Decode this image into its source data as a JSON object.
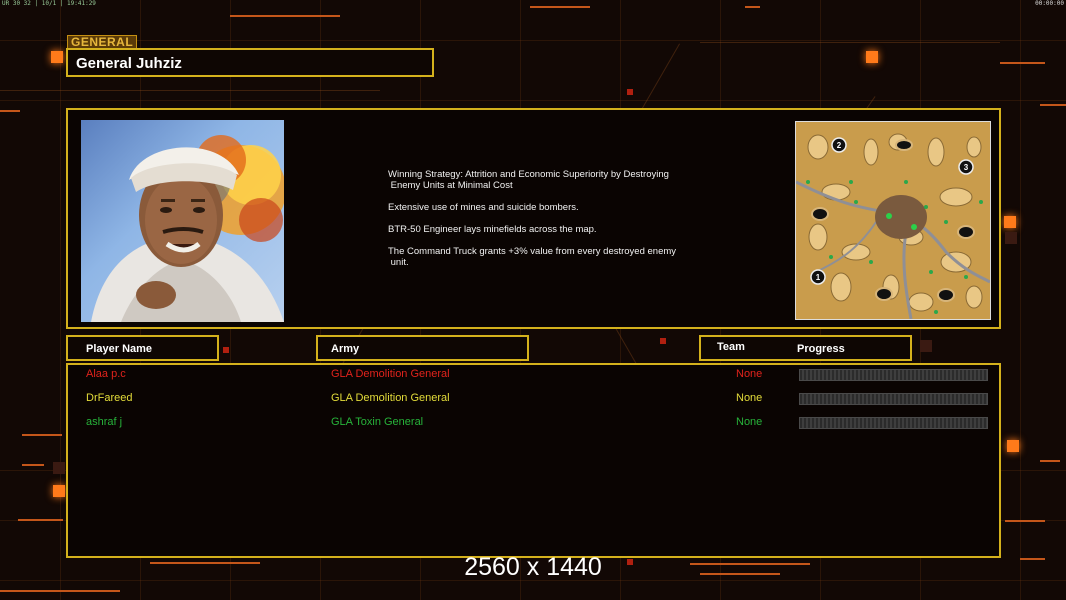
{
  "top_bar": {
    "left_text": "UR 30 32 | 10/1 | 19:41:29",
    "right_text": "00:00:00"
  },
  "general_tag": "GENERAL",
  "general_name": "General Juhziz",
  "description": [
    "Winning Strategy: Attrition and Economic Superiority by Destroying\n Enemy Units at Minimal Cost",
    "Extensive use of mines and suicide bombers.",
    "BTR-50 Engineer lays minefields across the map.",
    "The Command Truck grants +3% value from every destroyed enemy\n unit."
  ],
  "minimap": {
    "start_positions": [
      "2",
      "3",
      "1"
    ]
  },
  "headers": {
    "player_name": "Player Name",
    "army": "Army",
    "team": "Team",
    "progress": "Progress"
  },
  "players": [
    {
      "name": "Alaa p.c",
      "army": "GLA Demolition General",
      "team": "None",
      "color": "#e0231c"
    },
    {
      "name": "DrFareed",
      "army": "GLA Demolition General",
      "team": "None",
      "color": "#e3dc3a"
    },
    {
      "name": "ashraf j",
      "army": "GLA Toxin General",
      "team": "None",
      "color": "#27b33a"
    }
  ],
  "resolution_caption": "2560 x 1440",
  "colors": {
    "accent": "#d4b11c",
    "background": "#120805",
    "highlight": "#ff7a1a"
  }
}
